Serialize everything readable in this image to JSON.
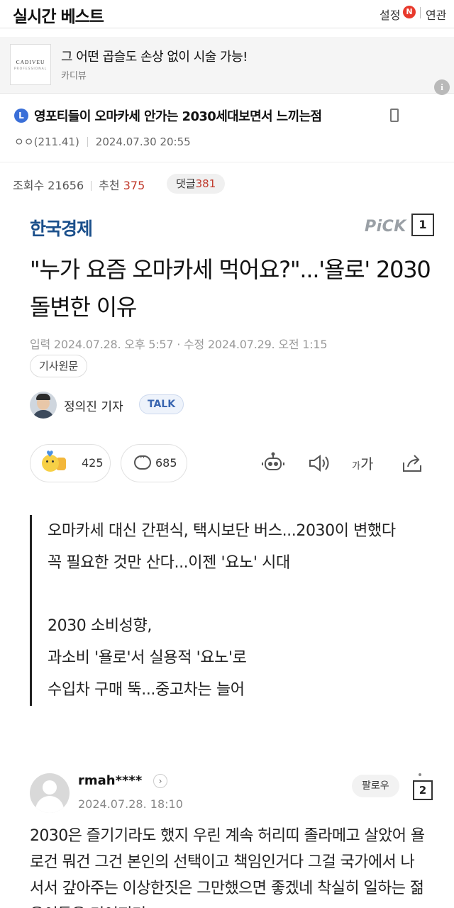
{
  "topbar": {
    "title": "실시간 베스트",
    "settings": "설정",
    "badge": "N",
    "related": "연관"
  },
  "ad": {
    "logo_text": "CADIVEU",
    "logo_sub": "PROFESSIONAL",
    "headline": "그 어떤 곱슬도 손상 없이 시술 가능!",
    "brand": "카디뷰",
    "info_icon": "i"
  },
  "post": {
    "badge": "L",
    "title": "영포티들이 오마카세 안가는 2030세대보면서 느끼는점",
    "author": "ㅇㅇ(211.41)",
    "datetime": "2024.07.30 20:55",
    "views_label": "조회수",
    "views": "21656",
    "recommend_label": "추천",
    "recommend": "375",
    "comments_label": "댓글",
    "comments": "381"
  },
  "article": {
    "press": "한국경제",
    "pick": "PiCK",
    "pick_num": "1",
    "title": "\"누가 요즘 오마카세 먹어요?\"...'욜로' 2030 돌변한 이유",
    "date": "입력 2024.07.28. 오후 5:57 · 수정 2024.07.29. 오전 1:15",
    "original_btn": "기사원문",
    "reporter": "정의진 기자",
    "talk": "TALK",
    "reaction_count": "425",
    "comment_count": "685",
    "font_small": "가",
    "font_large": "가",
    "summary_lines": [
      "오마카세 대신 간편식, 택시보단 버스...2030이 변했다",
      "꼭 필요한 것만 산다...이젠 '요노' 시대"
    ],
    "summary_lines2": [
      "2030 소비성향,",
      "과소비 '욜로'서 실용적 '요노'로",
      "수입차 구매 뚝...중고차는 늘어"
    ]
  },
  "comment": {
    "user": "rmah****",
    "chevron": "›",
    "date": "2024.07.28. 18:10",
    "follow": "팔로우",
    "num": "2",
    "body": "2030은 즐기기라도 했지 우린 계속 허리띠 졸라메고 살았어 욜로건 뭐건 그건 본인의 선택이고 책임인거다 그걸 국가에서 나서서 갚아주는 이상한짓은 그만했으면 좋겠네 착실히 일하는 젊은이들은 미어지기"
  }
}
